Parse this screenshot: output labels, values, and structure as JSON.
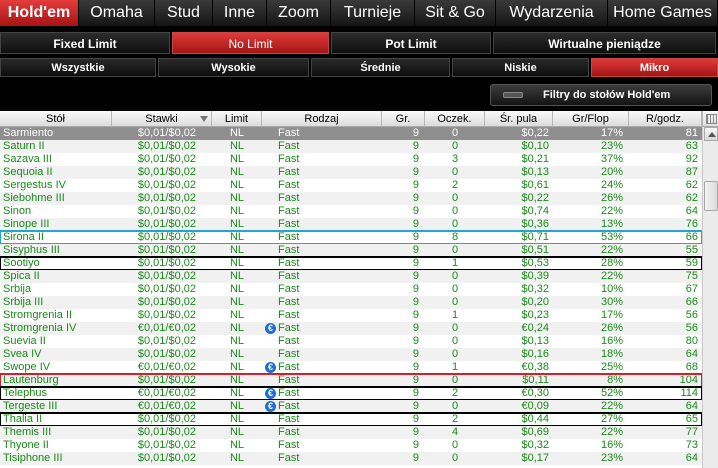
{
  "game_tabs": [
    "Hold'em",
    "Omaha",
    "Stud",
    "Inne",
    "Zoom",
    "Turnieje",
    "Sit & Go",
    "Wydarzenia",
    "Home Games"
  ],
  "limit_tabs": [
    "Fixed Limit",
    "No Limit",
    "Pot Limit",
    "Wirtualne pieniądze"
  ],
  "stake_tabs": [
    "Wszystkie",
    "Wysokie",
    "Średnie",
    "Niskie",
    "Mikro"
  ],
  "filter_button": "Filtry do stołów Hold'em",
  "columns": [
    "Stół",
    "Stawki",
    "Limit",
    "Rodzaj",
    "Gr.",
    "Oczek.",
    "Śr. pula",
    "Gr/Flop",
    "R/godz."
  ],
  "rows": [
    {
      "name": "Sarmiento",
      "stakes": "$0,01/$0,02",
      "limit": "NL",
      "type": "Fast",
      "players": "9",
      "wait": "0",
      "pot": "$0,22",
      "flop": "17%",
      "hands": "81"
    },
    {
      "name": "Saturn II",
      "stakes": "$0,01/$0,02",
      "limit": "NL",
      "type": "Fast",
      "players": "9",
      "wait": "0",
      "pot": "$0,10",
      "flop": "23%",
      "hands": "63"
    },
    {
      "name": "Sazava III",
      "stakes": "$0,01/$0,02",
      "limit": "NL",
      "type": "Fast",
      "players": "9",
      "wait": "3",
      "pot": "$0,21",
      "flop": "37%",
      "hands": "92"
    },
    {
      "name": "Sequoia II",
      "stakes": "$0,01/$0,02",
      "limit": "NL",
      "type": "Fast",
      "players": "9",
      "wait": "0",
      "pot": "$0,13",
      "flop": "20%",
      "hands": "87"
    },
    {
      "name": "Sergestus IV",
      "stakes": "$0,01/$0,02",
      "limit": "NL",
      "type": "Fast",
      "players": "9",
      "wait": "2",
      "pot": "$0,61",
      "flop": "24%",
      "hands": "62"
    },
    {
      "name": "Siebohme III",
      "stakes": "$0,01/$0,02",
      "limit": "NL",
      "type": "Fast",
      "players": "9",
      "wait": "0",
      "pot": "$0,22",
      "flop": "26%",
      "hands": "62"
    },
    {
      "name": "Sinon",
      "stakes": "$0,01/$0,02",
      "limit": "NL",
      "type": "Fast",
      "players": "9",
      "wait": "0",
      "pot": "$0,74",
      "flop": "22%",
      "hands": "64"
    },
    {
      "name": "Sinope III",
      "stakes": "$0,01/$0,02",
      "limit": "NL",
      "type": "Fast",
      "players": "9",
      "wait": "0",
      "pot": "$0,36",
      "flop": "13%",
      "hands": "76"
    },
    {
      "name": "Sirona II",
      "stakes": "$0,01/$0,02",
      "limit": "NL",
      "type": "Fast",
      "players": "9",
      "wait": "8",
      "pot": "$0,71",
      "flop": "53%",
      "hands": "66"
    },
    {
      "name": "Sisyphus III",
      "stakes": "$0,01/$0,02",
      "limit": "NL",
      "type": "Fast",
      "players": "9",
      "wait": "0",
      "pot": "$0,51",
      "flop": "22%",
      "hands": "55"
    },
    {
      "name": "Sootiyo",
      "stakes": "$0,01/$0,02",
      "limit": "NL",
      "type": "Fast",
      "players": "9",
      "wait": "1",
      "pot": "$0,53",
      "flop": "28%",
      "hands": "59"
    },
    {
      "name": "Spica II",
      "stakes": "$0,01/$0,02",
      "limit": "NL",
      "type": "Fast",
      "players": "9",
      "wait": "0",
      "pot": "$0,39",
      "flop": "22%",
      "hands": "75"
    },
    {
      "name": "Srbija",
      "stakes": "$0,01/$0,02",
      "limit": "NL",
      "type": "Fast",
      "players": "9",
      "wait": "0",
      "pot": "$0,32",
      "flop": "10%",
      "hands": "67"
    },
    {
      "name": "Srbija III",
      "stakes": "$0,01/$0,02",
      "limit": "NL",
      "type": "Fast",
      "players": "9",
      "wait": "0",
      "pot": "$0,20",
      "flop": "30%",
      "hands": "66"
    },
    {
      "name": "Stromgrenia II",
      "stakes": "$0,01/$0,02",
      "limit": "NL",
      "type": "Fast",
      "players": "9",
      "wait": "1",
      "pot": "$0,23",
      "flop": "17%",
      "hands": "56"
    },
    {
      "name": "Stromgrenia IV",
      "stakes": "€0,01/€0,02",
      "limit": "NL",
      "type": "Fast",
      "euro": true,
      "players": "9",
      "wait": "0",
      "pot": "€0,24",
      "flop": "26%",
      "hands": "56"
    },
    {
      "name": "Suevia II",
      "stakes": "$0,01/$0,02",
      "limit": "NL",
      "type": "Fast",
      "players": "9",
      "wait": "0",
      "pot": "$0,13",
      "flop": "16%",
      "hands": "80"
    },
    {
      "name": "Svea IV",
      "stakes": "$0,01/$0,02",
      "limit": "NL",
      "type": "Fast",
      "players": "9",
      "wait": "0",
      "pot": "$0,16",
      "flop": "18%",
      "hands": "64"
    },
    {
      "name": "Swope IV",
      "stakes": "€0,01/€0,02",
      "limit": "NL",
      "type": "Fast",
      "euro": true,
      "players": "9",
      "wait": "1",
      "pot": "€0,38",
      "flop": "25%",
      "hands": "68"
    },
    {
      "name": "Lautenburg",
      "stakes": "$0,01/$0,02",
      "limit": "NL",
      "type": "Fast",
      "players": "9",
      "wait": "0",
      "pot": "$0,11",
      "flop": "8%",
      "hands": "104"
    },
    {
      "name": "Telephus",
      "stakes": "€0,01/€0,02",
      "limit": "NL",
      "type": "Fast",
      "euro": true,
      "players": "9",
      "wait": "2",
      "pot": "€0,30",
      "flop": "52%",
      "hands": "114"
    },
    {
      "name": "Tergeste III",
      "stakes": "€0,01/€0,02",
      "limit": "NL",
      "type": "Fast",
      "euro": true,
      "players": "9",
      "wait": "0",
      "pot": "€0,09",
      "flop": "22%",
      "hands": "64"
    },
    {
      "name": "Thalia II",
      "stakes": "$0,01/$0,02",
      "limit": "NL",
      "type": "Fast",
      "players": "9",
      "wait": "2",
      "pot": "$0,44",
      "flop": "27%",
      "hands": "65"
    },
    {
      "name": "Themis III",
      "stakes": "$0,01/$0,02",
      "limit": "NL",
      "type": "Fast",
      "players": "9",
      "wait": "4",
      "pot": "$0,69",
      "flop": "22%",
      "hands": "77"
    },
    {
      "name": "Thyone II",
      "stakes": "$0,01/$0,02",
      "limit": "NL",
      "type": "Fast",
      "players": "9",
      "wait": "0",
      "pot": "$0,32",
      "flop": "16%",
      "hands": "73"
    },
    {
      "name": "Tisiphone III",
      "stakes": "$0,01/$0,02",
      "limit": "NL",
      "type": "Fast",
      "players": "9",
      "wait": "0",
      "pot": "$0,17",
      "flop": "23%",
      "hands": "64"
    }
  ],
  "colors": {
    "active_tab": "#c62828",
    "row_text": "#1a8a1a",
    "highlight_blue": "#1fa6d8",
    "highlight_red": "#d3202a",
    "highlight_black": "#000000"
  }
}
